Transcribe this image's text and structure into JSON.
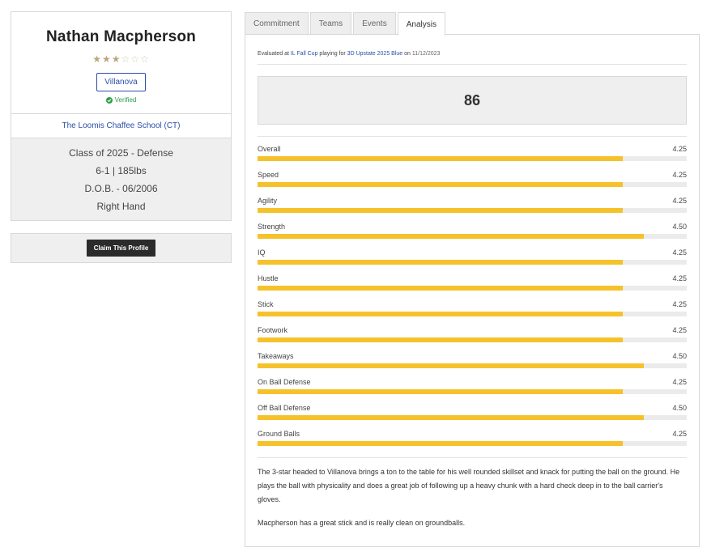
{
  "player": {
    "name": "Nathan Macpherson",
    "stars_filled": 3,
    "stars_total": 6,
    "commitment": "Villanova",
    "verified_label": "Verified",
    "school": "The Loomis Chaffee School (CT)",
    "class_position": "Class of 2025 - Defense",
    "height_weight": "6-1 | 185lbs",
    "dob": "D.O.B. - 06/2006",
    "hand": "Right Hand",
    "claim_label": "Claim This Profile"
  },
  "tabs": [
    "Commitment",
    "Teams",
    "Events",
    "Analysis"
  ],
  "active_tab": "Analysis",
  "evaluation": {
    "prefix": "Evaluated at",
    "event": "IL Fall Cup",
    "middle": "playing for",
    "team": "3D Upstate 2025 Blue",
    "on": "on",
    "date": "11/12/2023",
    "overall_score": "86"
  },
  "ratings": [
    {
      "label": "Overall",
      "value": "4.25",
      "fill": 0.85
    },
    {
      "label": "Speed",
      "value": "4.25",
      "fill": 0.85
    },
    {
      "label": "Agility",
      "value": "4.25",
      "fill": 0.85
    },
    {
      "label": "Strength",
      "value": "4.50",
      "fill": 0.9
    },
    {
      "label": "IQ",
      "value": "4.25",
      "fill": 0.85
    },
    {
      "label": "Hustle",
      "value": "4.25",
      "fill": 0.85
    },
    {
      "label": "Stick",
      "value": "4.25",
      "fill": 0.85
    },
    {
      "label": "Footwork",
      "value": "4.25",
      "fill": 0.85
    },
    {
      "label": "Takeaways",
      "value": "4.50",
      "fill": 0.9
    },
    {
      "label": "On Ball Defense",
      "value": "4.25",
      "fill": 0.85
    },
    {
      "label": "Off Ball Defense",
      "value": "4.50",
      "fill": 0.9
    },
    {
      "label": "Ground Balls",
      "value": "4.25",
      "fill": 0.85
    }
  ],
  "writeup": [
    "The 3-star headed to Villanova brings a ton to the table for his well rounded skillset and knack for putting the ball on the ground. He plays the ball with physicality and does a great job of following up a heavy chunk with a hard check deep in to the ball carrier's gloves.",
    "Macpherson has a great stick and is really clean on groundballs."
  ],
  "colors": {
    "bar": "#f6c22b",
    "link": "#2b4fa8",
    "verified": "#2e9b4a"
  }
}
